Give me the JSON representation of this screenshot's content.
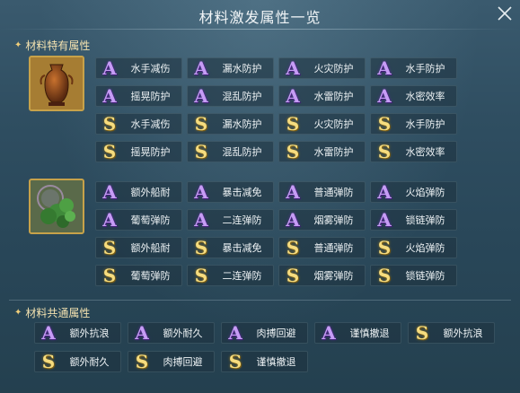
{
  "title": "材料激发属性一览",
  "sections": {
    "specific": {
      "heading": "材料特有属性",
      "materials": [
        {
          "icon": "vase-icon",
          "rows": [
            [
              {
                "grade": "A",
                "label": "水手减伤"
              },
              {
                "grade": "A",
                "label": "漏水防护"
              },
              {
                "grade": "A",
                "label": "火灾防护"
              },
              {
                "grade": "A",
                "label": "水手防护"
              }
            ],
            [
              {
                "grade": "A",
                "label": "摇晃防护"
              },
              {
                "grade": "A",
                "label": "混乱防护"
              },
              {
                "grade": "A",
                "label": "水雷防护"
              },
              {
                "grade": "A",
                "label": "水密效率"
              }
            ],
            [
              {
                "grade": "S",
                "label": "水手减伤"
              },
              {
                "grade": "S",
                "label": "漏水防护"
              },
              {
                "grade": "S",
                "label": "火灾防护"
              },
              {
                "grade": "S",
                "label": "水手防护"
              }
            ],
            [
              {
                "grade": "S",
                "label": "摇晃防护"
              },
              {
                "grade": "S",
                "label": "混乱防护"
              },
              {
                "grade": "S",
                "label": "水雷防护"
              },
              {
                "grade": "S",
                "label": "水密效率"
              }
            ]
          ]
        },
        {
          "icon": "herb-icon",
          "rows": [
            [
              {
                "grade": "A",
                "label": "额外船耐"
              },
              {
                "grade": "A",
                "label": "暴击减免"
              },
              {
                "grade": "A",
                "label": "普通弹防"
              },
              {
                "grade": "A",
                "label": "火焰弹防"
              }
            ],
            [
              {
                "grade": "A",
                "label": "葡萄弹防"
              },
              {
                "grade": "A",
                "label": "二连弹防"
              },
              {
                "grade": "A",
                "label": "烟雾弹防"
              },
              {
                "grade": "A",
                "label": "锁链弹防"
              }
            ],
            [
              {
                "grade": "S",
                "label": "额外船耐"
              },
              {
                "grade": "S",
                "label": "暴击减免"
              },
              {
                "grade": "S",
                "label": "普通弹防"
              },
              {
                "grade": "S",
                "label": "火焰弹防"
              }
            ],
            [
              {
                "grade": "S",
                "label": "葡萄弹防"
              },
              {
                "grade": "S",
                "label": "二连弹防"
              },
              {
                "grade": "S",
                "label": "烟雾弹防"
              },
              {
                "grade": "S",
                "label": "锁链弹防"
              }
            ]
          ]
        }
      ]
    },
    "common": {
      "heading": "材料共通属性",
      "items": [
        {
          "grade": "A",
          "label": "额外抗浪"
        },
        {
          "grade": "A",
          "label": "额外耐久"
        },
        {
          "grade": "A",
          "label": "肉搏回避"
        },
        {
          "grade": "A",
          "label": "谨慎撤退"
        },
        {
          "grade": "S",
          "label": "额外抗浪"
        },
        {
          "grade": "S",
          "label": "额外耐久"
        },
        {
          "grade": "S",
          "label": "肉搏回避"
        },
        {
          "grade": "S",
          "label": "谨慎撤退"
        }
      ]
    }
  }
}
